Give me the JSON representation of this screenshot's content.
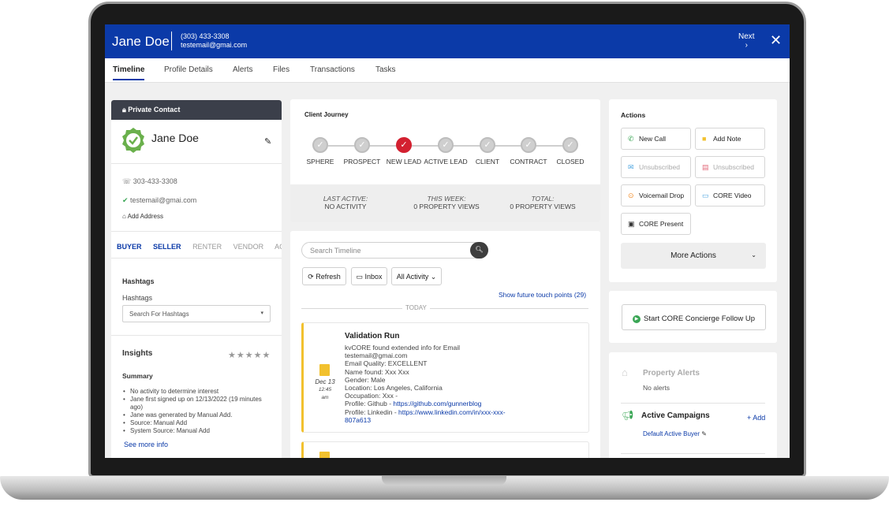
{
  "header": {
    "name": "Jane Doe",
    "phone": "(303) 433-3308",
    "email": "testemail@gmai.com",
    "next_label": "Next",
    "next_arrow": "›",
    "close_glyph": "✕"
  },
  "tabs": [
    "Timeline",
    "Profile Details",
    "Alerts",
    "Files",
    "Transactions",
    "Tasks"
  ],
  "active_tab": "Timeline",
  "contact": {
    "banner": "Private Contact",
    "name": "Jane Doe",
    "phone": "303-433-3308",
    "email": "testemail@gmai.com",
    "add_address": "Add Address",
    "roles": [
      "BUYER",
      "SELLER",
      "RENTER",
      "VENDOR",
      "AGENT"
    ],
    "active_roles": [
      "BUYER",
      "SELLER"
    ],
    "hashtags_heading": "Hashtags",
    "hashtags_label": "Hashtags",
    "hashtags_placeholder": "Search For Hashtags",
    "insights_heading": "Insights",
    "stars": "★★★★★",
    "summary_heading": "Summary",
    "summary": [
      "No activity to determine interest",
      "Jane first signed up on 12/13/2022 (19 minutes ago)",
      "Jane was generated by Manual Add.",
      "Source: Manual Add",
      "System Source: Manual Add"
    ],
    "see_more": "See more info"
  },
  "journey": {
    "title": "Client Journey",
    "stages": [
      "SPHERE",
      "PROSPECT",
      "NEW LEAD",
      "ACTIVE LEAD",
      "CLIENT",
      "CONTRACT",
      "CLOSED"
    ],
    "current_stage": "NEW LEAD",
    "footer": [
      {
        "label": "LAST ACTIVE:",
        "value": "NO ACTIVITY"
      },
      {
        "label": "THIS WEEK:",
        "value": "0 PROPERTY VIEWS"
      },
      {
        "label": "TOTAL:",
        "value": "0 PROPERTY VIEWS"
      }
    ]
  },
  "timeline": {
    "search_placeholder": "Search Timeline",
    "refresh": "Refresh",
    "inbox": "Inbox",
    "filter": "All Activity",
    "future_link": "Show future touch points (29)",
    "divider": "TODAY",
    "entry": {
      "date": "Dec 13",
      "time": "12:45 am",
      "title": "Validation Run",
      "lines": [
        "kvCORE found extended info for Email",
        "testemail@gmai.com",
        "Email Quality: EXCELLENT",
        "Name found: Xxx Xxx",
        "Gender: Male",
        "Location: Los Angeles, California",
        "Occupation: Xxx -"
      ],
      "github_label": "Profile: Github - ",
      "github_url": "https://github.com/gunnerblog",
      "linkedin_label": "Profile: Linkedin - ",
      "linkedin_url": "https://www.linkedin.com/in/xxx-xxx-",
      "linkedin_url_tail": "807a613"
    }
  },
  "actions": {
    "title": "Actions",
    "buttons": [
      {
        "label": "New Call",
        "icon": "phone-icon",
        "color": "#3aa655"
      },
      {
        "label": "Add Note",
        "icon": "note-icon",
        "color": "#f2c12e"
      },
      {
        "label": "Unsubscribed",
        "icon": "email-icon",
        "color": "#4aa3df"
      },
      {
        "label": "Unsubscribed",
        "icon": "sms-icon",
        "color": "#e26a7a"
      },
      {
        "label": "Voicemail Drop",
        "icon": "voicemail-icon",
        "color": "#f28c28"
      },
      {
        "label": "CORE Video",
        "icon": "video-icon",
        "color": "#4aa3df"
      },
      {
        "label": "CORE Present",
        "icon": "present-icon",
        "color": "#333333"
      }
    ],
    "more": "More Actions",
    "concierge": "Start CORE Concierge Follow Up"
  },
  "alerts": {
    "title": "Property Alerts",
    "none": "No alerts",
    "campaigns_title": "Active Campaigns",
    "add": "+ Add",
    "default_campaign": "Default Active Buyer"
  }
}
